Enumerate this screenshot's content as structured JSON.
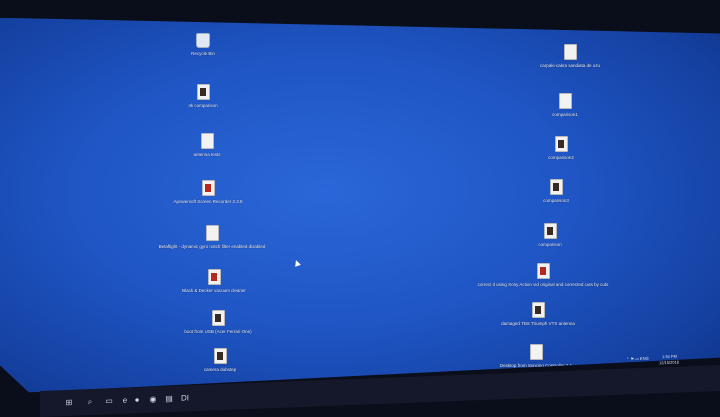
{
  "desktop": {
    "left_icons": [
      {
        "label": "Recycle Bin",
        "icon": "recycle-bin-icon",
        "style": "bin"
      },
      {
        "label": "4k comparison",
        "icon": "video-file-icon",
        "style": "dark"
      },
      {
        "label": "antenna tests",
        "icon": "file-icon",
        "style": "plain"
      },
      {
        "label": "Apowersoft Screen Recorder 2.3.8",
        "icon": "app-shortcut-icon",
        "style": "red"
      },
      {
        "label": "Betaflight - dynamic gyro notch filter enabled disabled",
        "icon": "video-file-icon",
        "style": "plain"
      },
      {
        "label": "Black & Decker vacuum cleaner",
        "icon": "video-file-icon",
        "style": "red"
      },
      {
        "label": "boot from USB (Acer Ferrari One)",
        "icon": "video-file-icon",
        "style": "dark"
      },
      {
        "label": "camera dubstep",
        "icon": "video-file-icon",
        "style": "dark"
      }
    ],
    "right_icons": [
      {
        "label": "carpaki-cakra sandiata de ozu",
        "icon": "video-file-icon",
        "style": "plain"
      },
      {
        "label": "comparison1",
        "icon": "video-file-icon",
        "style": "plain"
      },
      {
        "label": "comparison2",
        "icon": "video-file-icon",
        "style": "dark"
      },
      {
        "label": "comparison3",
        "icon": "video-file-icon",
        "style": "dark"
      },
      {
        "label": "comparison",
        "icon": "video-file-icon",
        "style": "dark"
      },
      {
        "label": "correct it using Sony Action vid original and corrected cuts by cuts",
        "icon": "video-file-icon",
        "style": "red"
      },
      {
        "label": "damaged TBS Triumph VTX antenna",
        "icon": "video-file-icon",
        "style": "dark"
      },
      {
        "label": "Desktop from Syncing Controller 2.1",
        "icon": "video-file-icon",
        "style": "plain"
      }
    ]
  },
  "taskbar": {
    "items": [
      {
        "name": "start-button",
        "glyph": "⊞"
      },
      {
        "name": "search-icon",
        "glyph": "⌕"
      },
      {
        "name": "task-view-icon",
        "glyph": "▭"
      },
      {
        "name": "edge-icon",
        "glyph": "e"
      },
      {
        "name": "firefox-icon",
        "glyph": "●"
      },
      {
        "name": "chrome-icon",
        "glyph": "◉"
      },
      {
        "name": "explorer-icon",
        "glyph": "▤"
      },
      {
        "name": "app-di-icon",
        "glyph": "DI"
      }
    ],
    "clock_time": "1:34 PM",
    "clock_date": "12/15/2018"
  }
}
